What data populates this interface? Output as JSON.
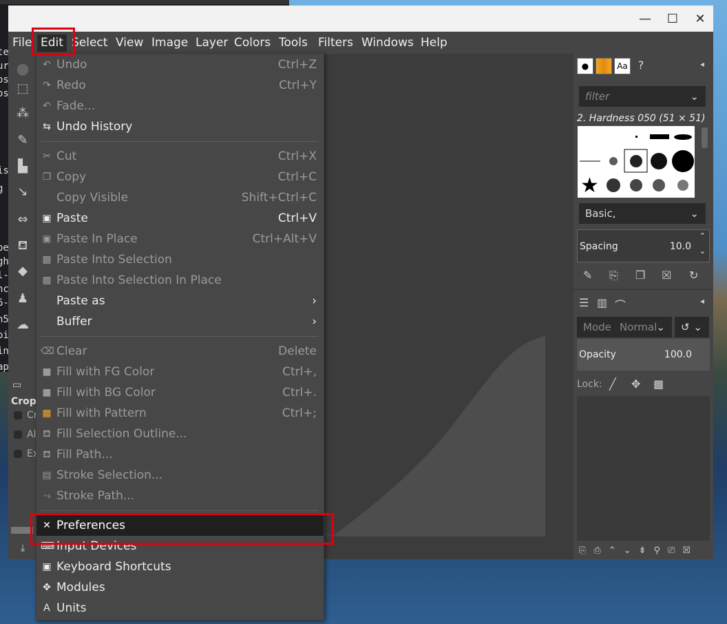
{
  "terminal": {
    "lines": [
      "te",
      "ur",
      "os",
      "os",
      "is",
      "g",
      "pe",
      "gh",
      "l-",
      "nc",
      "6-",
      "n5",
      "oi",
      "in",
      "ap"
    ]
  },
  "window": {
    "controls": {
      "minimize": "—",
      "maximize": "☐",
      "close": "✕"
    }
  },
  "menubar": [
    "File",
    "Edit",
    "Select",
    "View",
    "Image",
    "Layer",
    "Colors",
    "Tools",
    "Filters",
    "Windows",
    "Help"
  ],
  "edit_menu": [
    {
      "label": "Undo",
      "shortcut": "Ctrl+Z",
      "icon": "undo-icon",
      "glyph": "↶",
      "disabled": true
    },
    {
      "label": "Redo",
      "shortcut": "Ctrl+Y",
      "icon": "redo-icon",
      "glyph": "↷",
      "disabled": true
    },
    {
      "label": "Fade...",
      "shortcut": "",
      "icon": "fade-icon",
      "glyph": "↶",
      "disabled": true
    },
    {
      "label": "Undo History",
      "shortcut": "",
      "icon": "undo-history-icon",
      "glyph": "⇆",
      "disabled": false
    },
    {
      "sep": true
    },
    {
      "label": "Cut",
      "shortcut": "Ctrl+X",
      "icon": "scissors-icon",
      "glyph": "✂",
      "disabled": true
    },
    {
      "label": "Copy",
      "shortcut": "Ctrl+C",
      "icon": "copy-icon",
      "glyph": "❐",
      "disabled": true
    },
    {
      "label": "Copy Visible",
      "shortcut": "Shift+Ctrl+C",
      "icon": "",
      "glyph": "",
      "disabled": true
    },
    {
      "label": "Paste",
      "shortcut": "Ctrl+V",
      "icon": "paste-icon",
      "glyph": "▣",
      "disabled": false
    },
    {
      "label": "Paste In Place",
      "shortcut": "Ctrl+Alt+V",
      "icon": "paste-in-place-icon",
      "glyph": "▣",
      "disabled": true
    },
    {
      "label": "Paste Into Selection",
      "shortcut": "",
      "icon": "paste-into-icon",
      "glyph": "▩",
      "disabled": true
    },
    {
      "label": "Paste Into Selection In Place",
      "shortcut": "",
      "icon": "paste-into-place-icon",
      "glyph": "▩",
      "disabled": true
    },
    {
      "label": "Paste as",
      "shortcut": "›",
      "icon": "",
      "glyph": "",
      "disabled": false
    },
    {
      "label": "Buffer",
      "shortcut": "›",
      "icon": "",
      "glyph": "",
      "disabled": false
    },
    {
      "sep": true
    },
    {
      "label": "Clear",
      "shortcut": "Delete",
      "icon": "clear-icon",
      "glyph": "⌫",
      "disabled": true
    },
    {
      "label": "Fill with FG Color",
      "shortcut": "Ctrl+,",
      "icon": "fg-color-icon",
      "glyph": "■",
      "disabled": true
    },
    {
      "label": "Fill with BG Color",
      "shortcut": "Ctrl+.",
      "icon": "bg-color-icon",
      "glyph": "■",
      "disabled": true
    },
    {
      "label": "Fill with Pattern",
      "shortcut": "Ctrl+;",
      "icon": "pattern-icon",
      "glyph": "▦",
      "disabled": true
    },
    {
      "label": "Fill Selection Outline...",
      "shortcut": "",
      "icon": "bucket-icon",
      "glyph": "⛾",
      "disabled": true
    },
    {
      "label": "Fill Path...",
      "shortcut": "",
      "icon": "bucket-icon",
      "glyph": "⛾",
      "disabled": true
    },
    {
      "label": "Stroke Selection...",
      "shortcut": "",
      "icon": "stroke-selection-icon",
      "glyph": "▤",
      "disabled": true
    },
    {
      "label": "Stroke Path...",
      "shortcut": "",
      "icon": "stroke-path-icon",
      "glyph": "⤳",
      "disabled": true
    },
    {
      "sep": true
    },
    {
      "label": "Preferences",
      "shortcut": "",
      "icon": "preferences-icon",
      "glyph": "✕",
      "disabled": false,
      "highlighted": true
    },
    {
      "label": "Input Devices",
      "shortcut": "",
      "icon": "input-devices-icon",
      "glyph": "⌨",
      "disabled": false
    },
    {
      "label": "Keyboard Shortcuts",
      "shortcut": "",
      "icon": "keyboard-icon",
      "glyph": "▣",
      "disabled": false
    },
    {
      "label": "Modules",
      "shortcut": "",
      "icon": "modules-icon",
      "glyph": "✥",
      "disabled": false
    },
    {
      "label": "Units",
      "shortcut": "",
      "icon": "units-icon",
      "glyph": "Ａ",
      "disabled": false
    }
  ],
  "tool_options": {
    "title": "Crop",
    "options": [
      "Cr",
      "Al",
      "Ex"
    ]
  },
  "brushes": {
    "filter_placeholder": "filter",
    "selected": "2. Hardness 050 (51 × 51)",
    "tag": "Basic,",
    "spacing_label": "Spacing",
    "spacing_value": "10.0"
  },
  "layers": {
    "mode_label": "Mode",
    "mode_value": "Normal",
    "opacity_label": "Opacity",
    "opacity_value": "100.0",
    "lock_label": "Lock:"
  },
  "colors": {
    "highlight_box": "#e00010",
    "menu_bg": "#474747",
    "pattern_orange": "#f5a623"
  }
}
